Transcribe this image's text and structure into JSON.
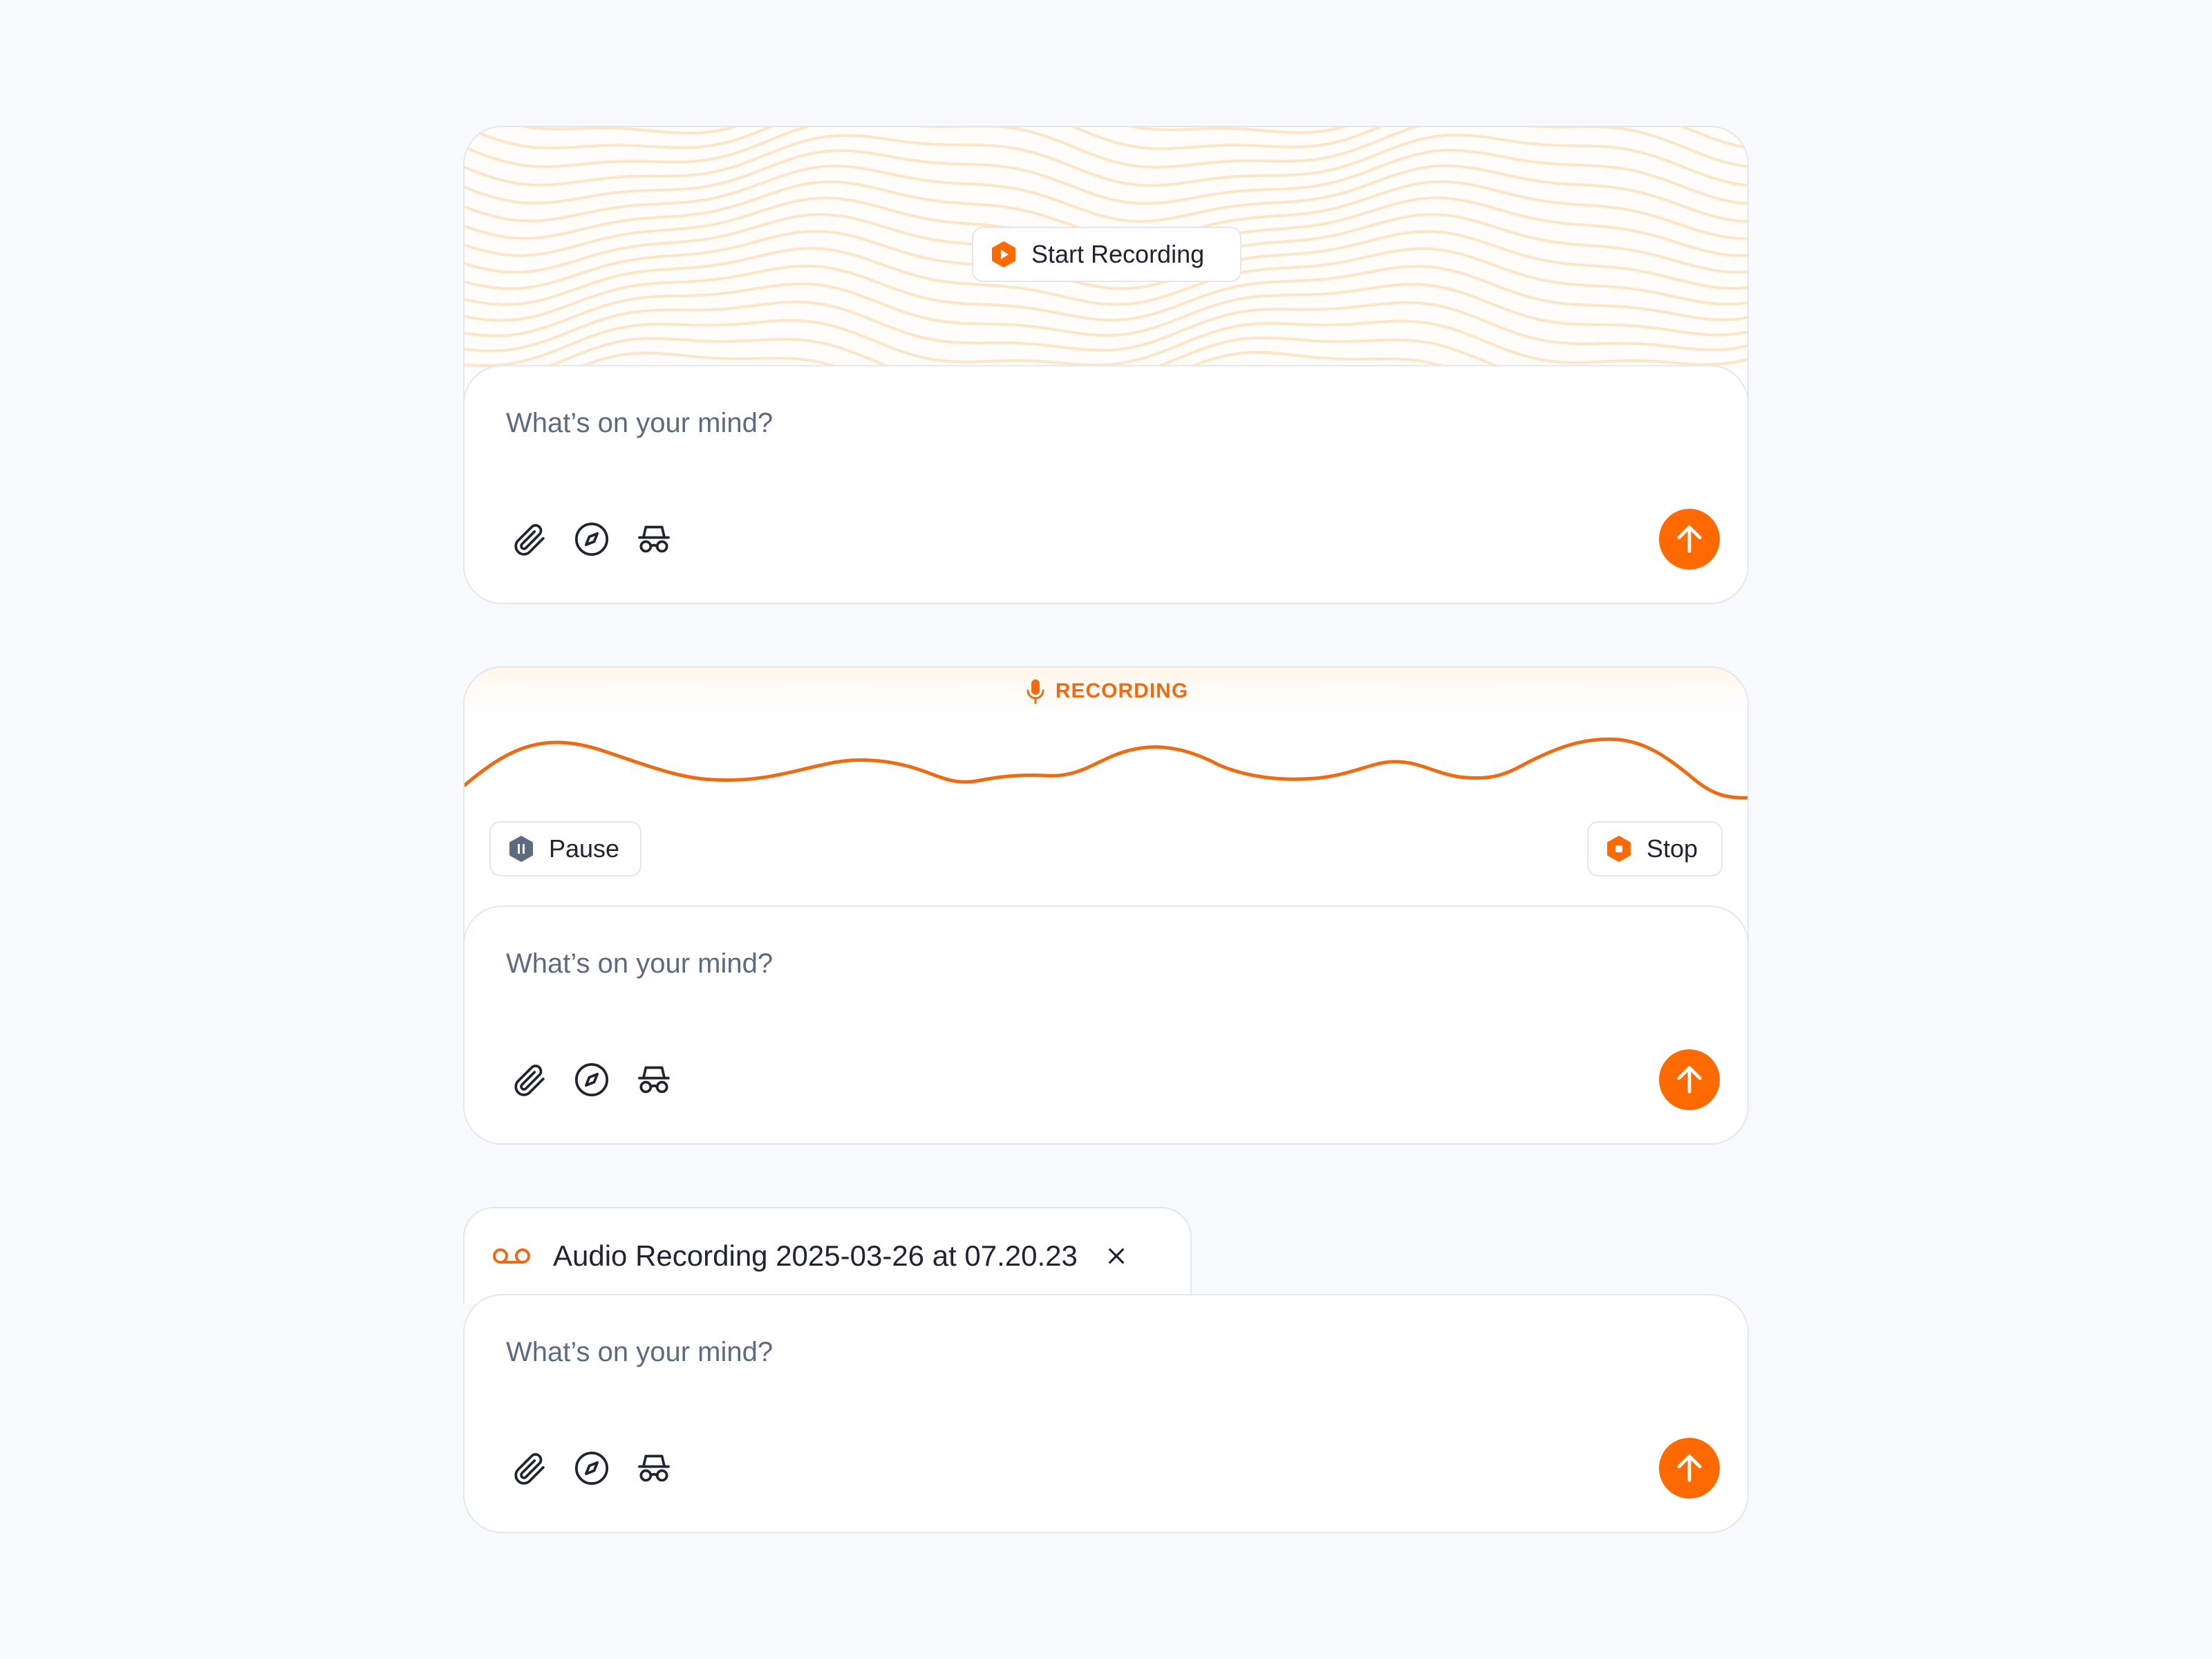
{
  "colors": {
    "accent": "#ff6a00",
    "recording_label": "#f26a0f",
    "pause_icon": "#5d6b80",
    "placeholder": "#5d6b80",
    "border": "#e3e7ee",
    "background": "#f7f9fb",
    "wave_pattern": "#fde6c8"
  },
  "idle_card": {
    "start_button": {
      "label": "Start Recording",
      "icon": "hexagon-play-icon"
    },
    "composer": {
      "placeholder": "What’s on your mind?",
      "tools": [
        "paperclip-icon",
        "compass-icon",
        "incognito-icon"
      ],
      "send_icon": "arrow-up-icon"
    }
  },
  "recording_card": {
    "status": {
      "label": "RECORDING",
      "icon": "microphone-icon"
    },
    "pause_button": {
      "label": "Pause",
      "icon": "hexagon-pause-icon"
    },
    "stop_button": {
      "label": "Stop",
      "icon": "hexagon-stop-icon"
    },
    "composer": {
      "placeholder": "What’s on your mind?",
      "tools": [
        "paperclip-icon",
        "compass-icon",
        "incognito-icon"
      ],
      "send_icon": "arrow-up-icon"
    }
  },
  "attached_card": {
    "attachment": {
      "name": "Audio Recording 2025-03-26 at 07.20.23",
      "icon": "voicemail-icon",
      "remove_icon": "close-icon"
    },
    "composer": {
      "placeholder": "What’s on your mind?",
      "tools": [
        "paperclip-icon",
        "compass-icon",
        "incognito-icon"
      ],
      "send_icon": "arrow-up-icon"
    }
  }
}
